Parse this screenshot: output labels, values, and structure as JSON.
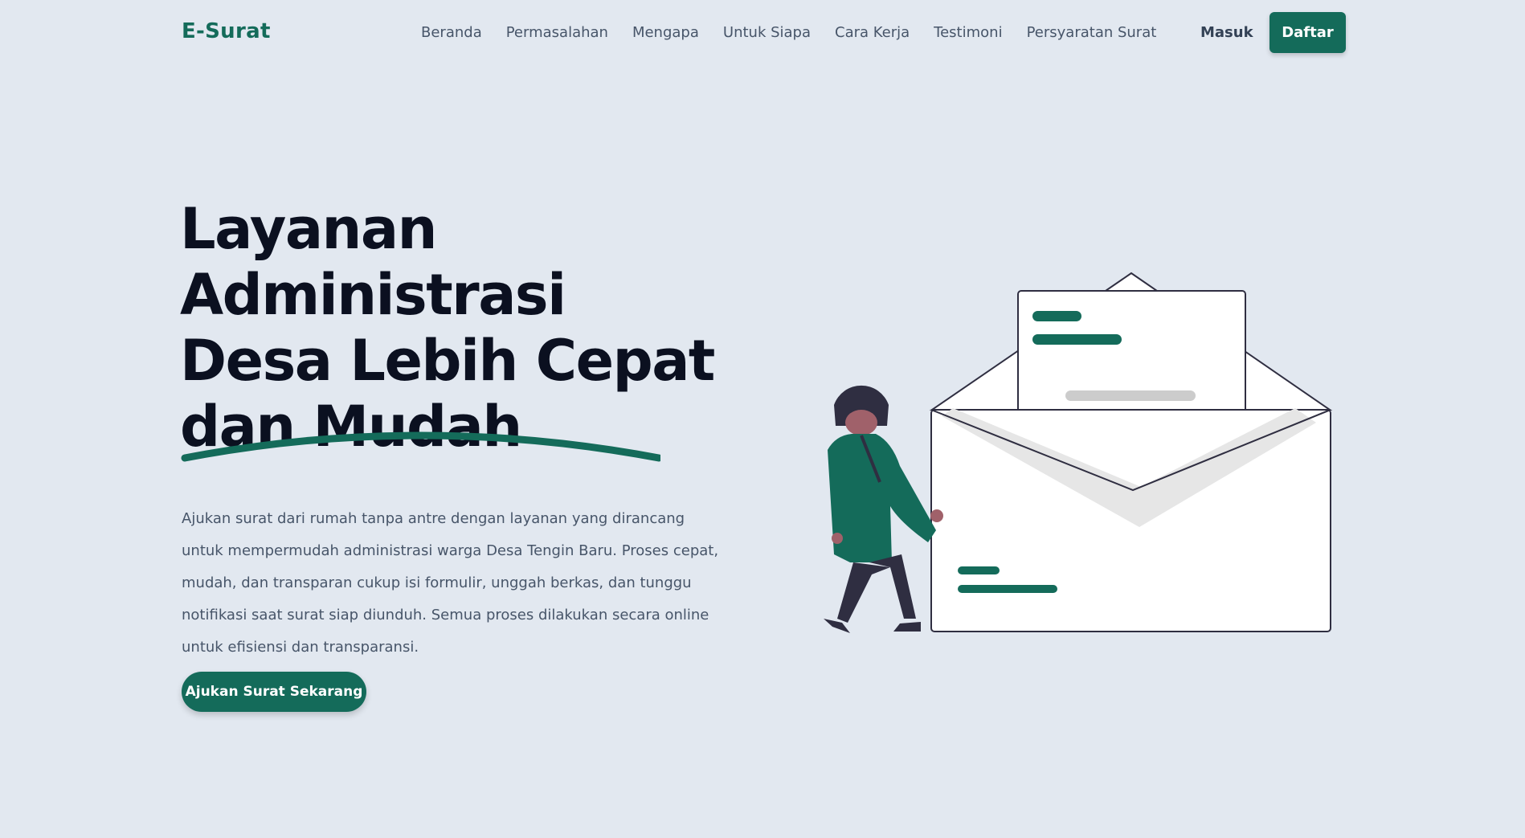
{
  "navbar": {
    "logo": "E-Surat",
    "links": [
      "Beranda",
      "Permasalahan",
      "Mengapa",
      "Untuk Siapa",
      "Cara Kerja",
      "Testimoni",
      "Persyaratan Surat"
    ],
    "login_label": "Masuk",
    "register_label": "Daftar"
  },
  "hero": {
    "title_lines": [
      "Layanan Administrasi",
      "Desa Lebih Cepat",
      "dan Mudah"
    ],
    "description": "Ajukan surat dari rumah tanpa antre dengan layanan yang dirancang untuk mempermudah administrasi warga Desa Tengin Baru. Proses cepat, mudah, dan transparan cukup isi formulir, unggah berkas, dan tunggu notifikasi saat surat siap diunduh. Semua proses dilakukan secara online untuk efisiensi dan transparansi.",
    "cta_label": "Ajukan Surat Sekarang"
  },
  "colors": {
    "brand": "#146b5a",
    "background": "#e2e8f0",
    "heading": "#0b1020",
    "body_text": "#475569"
  },
  "illustration": "person-with-open-envelope-illustration"
}
